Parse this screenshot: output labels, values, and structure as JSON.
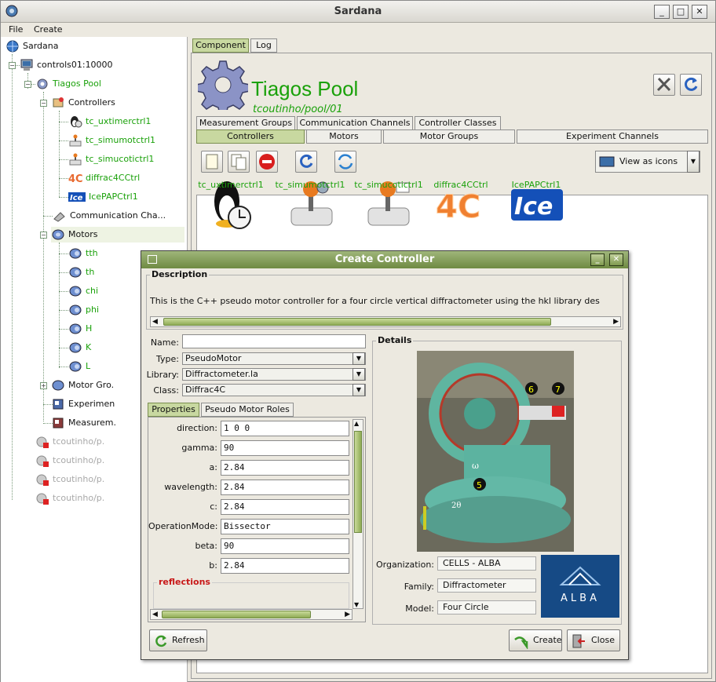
{
  "window": {
    "title": "Sardana"
  },
  "menu": [
    "File",
    "Create"
  ],
  "tree": {
    "root": "Sardana",
    "server": "controls01:10000",
    "pool": "Tiagos Pool",
    "controllers_label": "Controllers",
    "controllers": [
      "tc_uxtimerctrl1",
      "tc_simumotctrl1",
      "tc_simucotictrl1",
      "diffrac4CCtrl",
      "IcePAPCtrl1"
    ],
    "comm_label": "Communication Cha...",
    "motors_label": "Motors",
    "motors": [
      "tth",
      "th",
      "chi",
      "phi",
      "H",
      "K",
      "L"
    ],
    "motor_groups_label": "Motor Gro.",
    "experiment_label": "Experimen",
    "measurement_label": "Measurem.",
    "other_pools": [
      "tcoutinho/p.",
      "tcoutinho/p.",
      "tcoutinho/p.",
      "tcoutinho/p."
    ]
  },
  "top_tabs": [
    "Component",
    "Log"
  ],
  "pool": {
    "name": "Tiagos Pool",
    "path": "tcoutinho/pool/01"
  },
  "tabs_row1": [
    "Measurement Groups",
    "Communication Channels",
    "Controller Classes"
  ],
  "tabs_row2": [
    "Controllers",
    "Motors",
    "Motor Groups",
    "Experiment Channels"
  ],
  "view_combo": "View as icons",
  "controller_icons": [
    "tc_uxtimerctrl1",
    "tc_simumotctrl1",
    "tc_simucotictrl1",
    "diffrac4CCtrl",
    "IcePAPCtrl1"
  ],
  "dialog": {
    "title": "Create Controller",
    "description_label": "Description",
    "description": "This is the C++ pseudo motor controller for a four circle vertical diffractometer using the hkl library des",
    "name_label": "Name:",
    "name_value": "",
    "type_label": "Type:",
    "type_value": "PseudoMotor",
    "library_label": "Library:",
    "library_value": "Diffractometer.la",
    "class_label": "Class:",
    "class_value": "Diffrac4C",
    "prop_tabs": [
      "Properties",
      "Pseudo Motor Roles"
    ],
    "properties": [
      {
        "label": "direction:",
        "value": "1 0 0"
      },
      {
        "label": "gamma:",
        "value": "90"
      },
      {
        "label": "a:",
        "value": "2.84"
      },
      {
        "label": "wavelength:",
        "value": "2.84"
      },
      {
        "label": "c:",
        "value": "2.84"
      },
      {
        "label": "OperationMode:",
        "value": "Bissector"
      },
      {
        "label": "beta:",
        "value": "90"
      },
      {
        "label": "b:",
        "value": "2.84"
      }
    ],
    "reflections_label": "reflections",
    "details_label": "Details",
    "organization_label": "Organization:",
    "organization": "CELLS - ALBA",
    "family_label": "Family:",
    "family": "Diffractometer",
    "model_label": "Model:",
    "model": "Four Circle",
    "alba_logo": "ALBA",
    "refresh": "Refresh",
    "create": "Create",
    "close": "Close"
  }
}
